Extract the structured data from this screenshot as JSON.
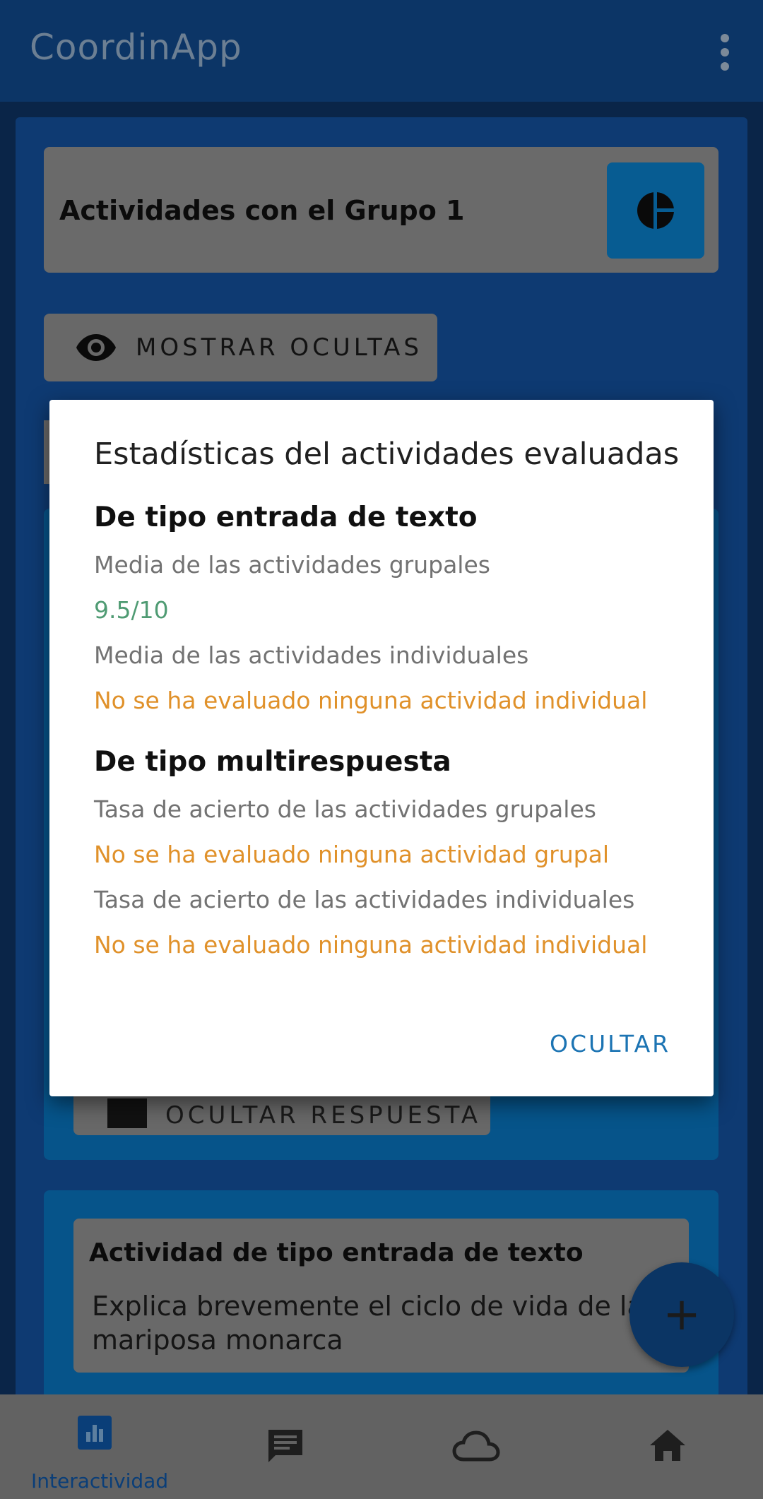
{
  "app": {
    "title": "CoordinApp"
  },
  "group_card": {
    "title": "Actividades con el Grupo 1"
  },
  "show_hidden_button": {
    "label": "MOSTRAR OCULTAS"
  },
  "hide_answer_button": {
    "label": "OCULTAR RESPUESTA"
  },
  "activity_card": {
    "type_label": "Actividad de tipo entrada de texto",
    "question": "Explica brevemente el ciclo de vida de la mariposa monarca"
  },
  "fab": {
    "label": "+"
  },
  "bottom_nav": {
    "items": [
      {
        "label": "Interactividad",
        "icon": "bar-chart-icon",
        "active": true
      },
      {
        "label": "",
        "icon": "chat-icon"
      },
      {
        "label": "",
        "icon": "cloud-icon"
      },
      {
        "label": "",
        "icon": "home-icon"
      }
    ]
  },
  "dialog": {
    "title": "Estadísticas del actividades evaluadas",
    "sections": [
      {
        "title": "De tipo entrada de texto",
        "rows": [
          {
            "label": "Media de las actividades grupales",
            "value": "9.5/10",
            "status": "ok"
          },
          {
            "label": "Media de las actividades individuales",
            "value": "No se ha evaluado ninguna actividad individual",
            "status": "warn"
          }
        ]
      },
      {
        "title": "De tipo multirespuesta",
        "rows": [
          {
            "label": "Tasa de acierto de las actividades grupales",
            "value": "No se ha evaluado ninguna actividad grupal",
            "status": "warn"
          },
          {
            "label": "Tasa de acierto de las actividades individuales",
            "value": "No se ha evaluado ninguna actividad individual",
            "status": "warn"
          }
        ]
      }
    ],
    "action_label": "OCULTAR"
  },
  "colors": {
    "app_bar": "#0c3566",
    "accent": "#1c74b3",
    "ok": "#4f9b73",
    "warn": "#e0912a"
  }
}
